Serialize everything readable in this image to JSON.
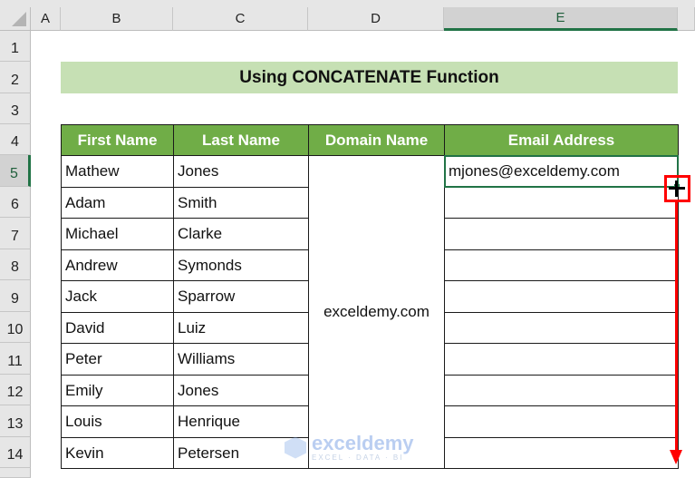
{
  "columns": [
    {
      "label": "A",
      "selected": false
    },
    {
      "label": "B",
      "selected": false
    },
    {
      "label": "C",
      "selected": false
    },
    {
      "label": "D",
      "selected": false
    },
    {
      "label": "E",
      "selected": true
    }
  ],
  "rows": [
    "1",
    "2",
    "3",
    "4",
    "5",
    "6",
    "7",
    "8",
    "9",
    "10",
    "11",
    "12",
    "13",
    "14"
  ],
  "selected_row": "5",
  "title": "Using CONCATENATE Function",
  "table": {
    "headers": [
      "First Name",
      "Last Name",
      "Domain Name",
      "Email Address"
    ],
    "records": [
      {
        "first": "Mathew",
        "last": "Jones",
        "email": "mjones@exceldemy.com"
      },
      {
        "first": "Adam",
        "last": "Smith",
        "email": ""
      },
      {
        "first": "Michael",
        "last": "Clarke",
        "email": ""
      },
      {
        "first": "Andrew",
        "last": "Symonds",
        "email": ""
      },
      {
        "first": "Jack",
        "last": "Sparrow",
        "email": ""
      },
      {
        "first": "David",
        "last": "Luiz",
        "email": ""
      },
      {
        "first": "Peter",
        "last": "Williams",
        "email": ""
      },
      {
        "first": "Emily",
        "last": "Jones",
        "email": ""
      },
      {
        "first": "Louis",
        "last": "Henrique",
        "email": ""
      },
      {
        "first": "Kevin",
        "last": "Petersen",
        "email": ""
      }
    ],
    "domain": "exceldemy.com"
  },
  "active_cell": "E5",
  "annotation": {
    "color": "#ff0000",
    "description": "Drag fill handle down"
  },
  "watermark": {
    "brand": "exceldemy",
    "tagline": "EXCEL · DATA · BI"
  },
  "colors": {
    "header_green": "#70ad47",
    "title_band": "#c6e0b4",
    "selection": "#217346"
  }
}
